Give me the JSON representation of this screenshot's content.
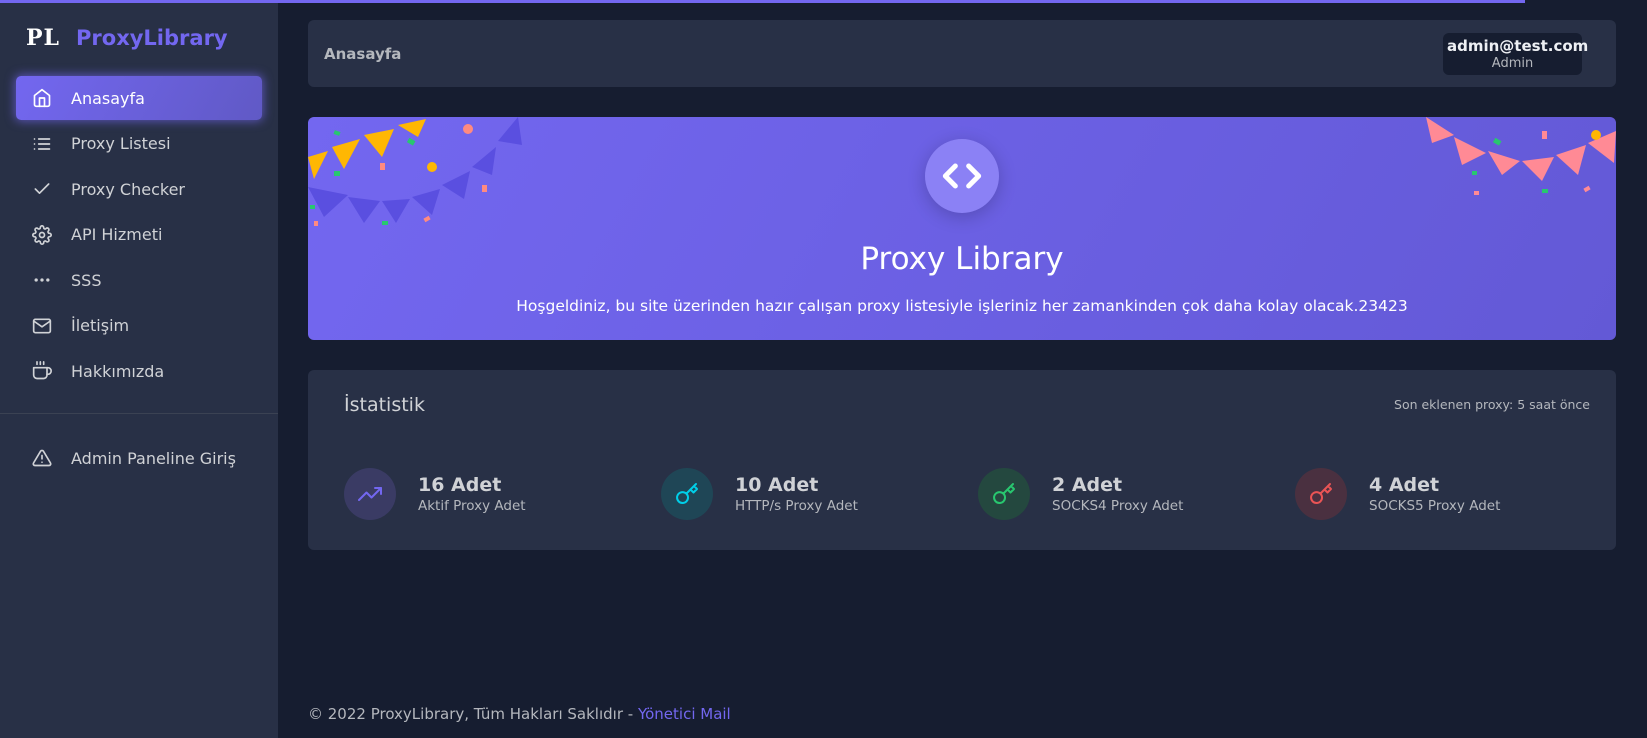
{
  "brand": {
    "logo": "PL",
    "name": "ProxyLibrary"
  },
  "sidebar": {
    "items": [
      {
        "label": "Anasayfa",
        "icon": "home-icon",
        "active": true
      },
      {
        "label": "Proxy Listesi",
        "icon": "list-icon"
      },
      {
        "label": "Proxy Checker",
        "icon": "check-icon"
      },
      {
        "label": "API Hizmeti",
        "icon": "gear-icon"
      },
      {
        "label": "SSS",
        "icon": "more-horizontal-icon"
      },
      {
        "label": "İletişim",
        "icon": "mail-icon"
      },
      {
        "label": "Hakkımızda",
        "icon": "coffee-icon"
      }
    ],
    "admin_item": {
      "label": "Admin Paneline Giriş",
      "icon": "alert-triangle-icon"
    }
  },
  "header": {
    "breadcrumb": "Anasayfa",
    "user": {
      "email": "admin@test.com",
      "role": "Admin"
    }
  },
  "banner": {
    "icon": "code-icon",
    "title": "Proxy Library",
    "text": "Hoşgeldiniz, bu site üzerinden hazır çalışan proxy listesiyle işleriniz her zamankinden çok daha kolay olacak.23423"
  },
  "stats": {
    "title": "İstatistik",
    "subtitle": "Son eklenen proxy: 5 saat önce",
    "items": [
      {
        "value": "16 Adet",
        "label": "Aktif Proxy Adet",
        "icon": "trending-up-icon",
        "color": "#7367f0",
        "bg": "#3a3b64"
      },
      {
        "value": "10 Adet",
        "label": "HTTP/s Proxy Adet",
        "icon": "key-icon",
        "color": "#00cfe8",
        "bg": "#1f4656"
      },
      {
        "value": "2 Adet",
        "label": "SOCKS4 Proxy Adet",
        "icon": "key-icon",
        "color": "#28c76f",
        "bg": "#24483f"
      },
      {
        "value": "4 Adet",
        "label": "SOCKS5 Proxy Adet",
        "icon": "key-icon",
        "color": "#ea5455",
        "bg": "#4a3040"
      }
    ]
  },
  "footer": {
    "text": "© 2022 ProxyLibrary, Tüm Hakları Saklıdır - ",
    "link": "Yönetici Mail"
  }
}
